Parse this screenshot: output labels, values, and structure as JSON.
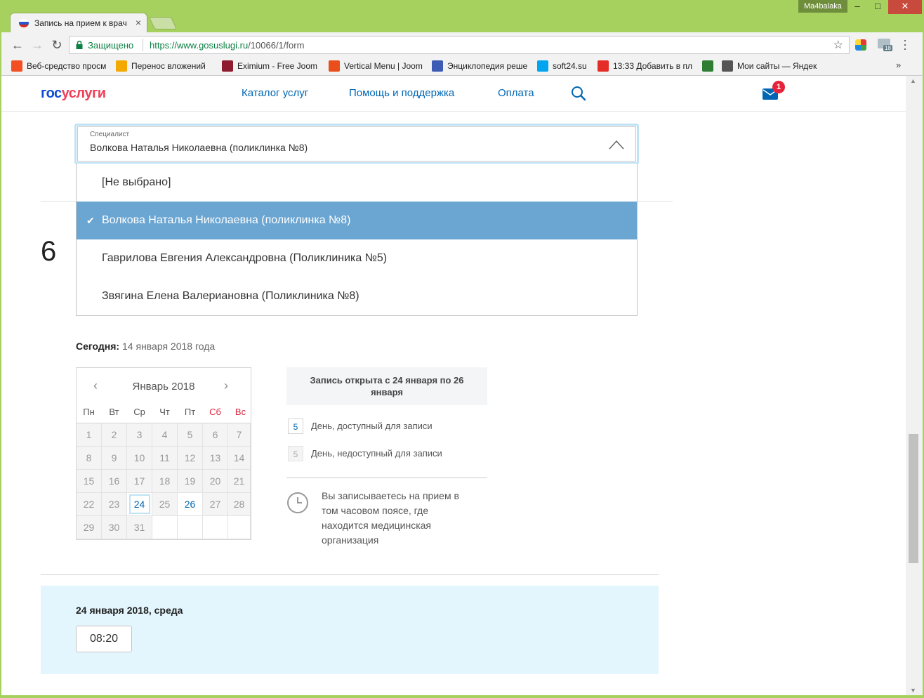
{
  "browser": {
    "tab_title": "Запись на прием к врач",
    "user": "Ma4balaka",
    "secure_label": "Защищено",
    "url_scheme_host": "https://www.gosuslugi.ru",
    "url_path": "/10066/1/form",
    "ext_badge": "18",
    "bookmarks": [
      {
        "label": "Веб-средство просм",
        "color": "#f25022"
      },
      {
        "label": "Перенос вложений",
        "color": "#f4a900"
      },
      {
        "label": "Eximium - Free Joom",
        "color": "#8e1b2f"
      },
      {
        "label": "Vertical Menu | Joom",
        "color": "#e94e1b"
      },
      {
        "label": "Энциклопедия реше",
        "color": "#3b5bb5"
      },
      {
        "label": "soft24.su",
        "color": "#00a4ef"
      },
      {
        "label": "13:33 Добавить в пл",
        "color": "#e52d27"
      },
      {
        "label": "",
        "color": "#2e7d32"
      },
      {
        "label": "Мои сайты — Яндек",
        "color": "#555555"
      }
    ]
  },
  "header": {
    "logo_gos": "гос",
    "logo_uslugi": "услуги",
    "nav": {
      "catalog": "Каталог услуг",
      "help": "Помощь и поддержка",
      "pay": "Оплата"
    },
    "mail_count": "1"
  },
  "form": {
    "step_number": "6",
    "specialist": {
      "label": "Специалист",
      "value": "Волкова Наталья Николаевна (поликлинка №8)",
      "options": [
        {
          "label": "[Не выбрано]",
          "selected": false
        },
        {
          "label": "Волкова Наталья Николаевна (поликлинка №8)",
          "selected": true
        },
        {
          "label": "Гаврилова Евгения Александровна (Поликлиника №5)",
          "selected": false
        },
        {
          "label": "Звягина Елена Валериановна (Поликлиника №8)",
          "selected": false
        }
      ]
    },
    "today_label": "Сегодня:",
    "today_value": " 14 января 2018 года"
  },
  "calendar": {
    "month": "Январь 2018",
    "weekdays": [
      "Пн",
      "Вт",
      "Ср",
      "Чт",
      "Пт",
      "Сб",
      "Вс"
    ],
    "weeks": [
      [
        "1",
        "2",
        "3",
        "4",
        "5",
        "6",
        "7"
      ],
      [
        "8",
        "9",
        "10",
        "11",
        "12",
        "13",
        "14"
      ],
      [
        "15",
        "16",
        "17",
        "18",
        "19",
        "20",
        "21"
      ],
      [
        "22",
        "23",
        "24",
        "25",
        "26",
        "27",
        "28"
      ],
      [
        "29",
        "30",
        "31",
        "",
        "",
        "",
        ""
      ]
    ],
    "available": [
      "24",
      "26"
    ],
    "selected": "24"
  },
  "info": {
    "open_text": "Запись открыта с 24 января по 26 января",
    "legend_available_num": "5",
    "legend_available": "День, доступный для записи",
    "legend_unavailable_num": "5",
    "legend_unavailable": "День, недоступный для записи",
    "timezone_note": "Вы записываетесь на прием в том часовом поясе, где находится медицинская организация"
  },
  "slots": {
    "date": "24 января 2018, среда",
    "times": [
      "08:20"
    ]
  }
}
